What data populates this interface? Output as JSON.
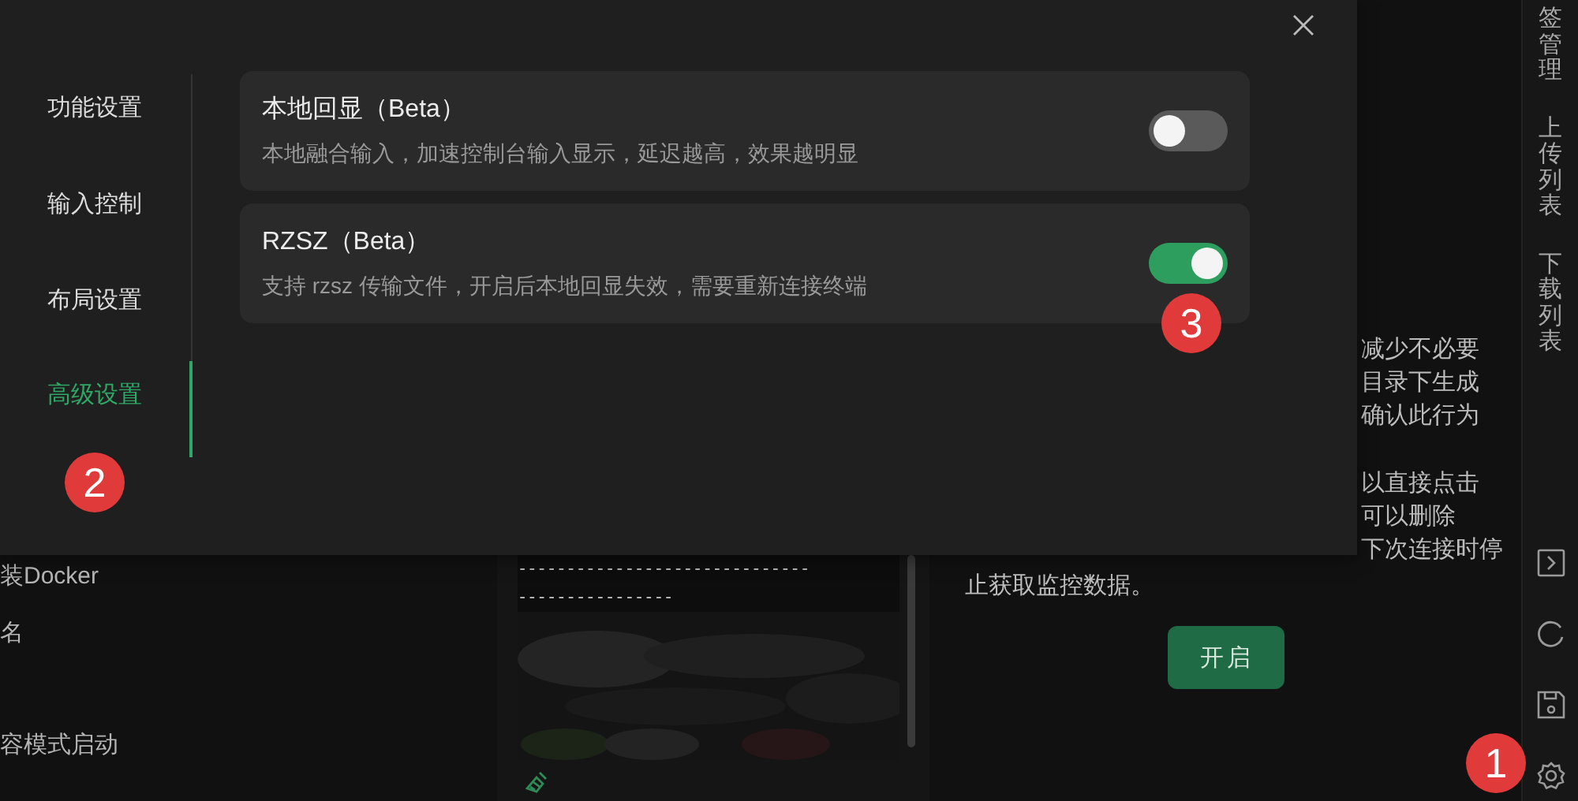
{
  "background": {
    "left_list": [
      {
        "label": "装Docker"
      },
      {
        "label": "名"
      },
      {
        "label": "容模式启动"
      }
    ],
    "terminal": {
      "lines": [
        "------------------------------",
        "----------------"
      ]
    },
    "info": {
      "paragraphs": [
        [
          "减少不必要",
          "目录下生成",
          "确认此行为"
        ],
        [
          "以直接点击",
          "可以删除",
          "下次连接时停"
        ]
      ],
      "last_line": "止获取监控数据。",
      "button": "开启"
    },
    "side_tabs": [
      {
        "label": "签管理"
      },
      {
        "label": "上传列表"
      },
      {
        "label": "下载列表"
      }
    ]
  },
  "dialog": {
    "nav": [
      {
        "label": "功能设置",
        "selected": false
      },
      {
        "label": "输入控制",
        "selected": false
      },
      {
        "label": "布局设置",
        "selected": false
      },
      {
        "label": "高级设置",
        "selected": true
      }
    ],
    "settings": [
      {
        "title": "本地回显（Beta）",
        "description": "本地融合输入，加速控制台输入显示，延迟越高，效果越明显",
        "on": false
      },
      {
        "title": "RZSZ（Beta）",
        "description": "支持 rzsz 传输文件，开启后本地回显失效，需要重新连接终端",
        "on": true
      }
    ]
  },
  "markers": [
    {
      "number": "1"
    },
    {
      "number": "2"
    },
    {
      "number": "3"
    }
  ]
}
